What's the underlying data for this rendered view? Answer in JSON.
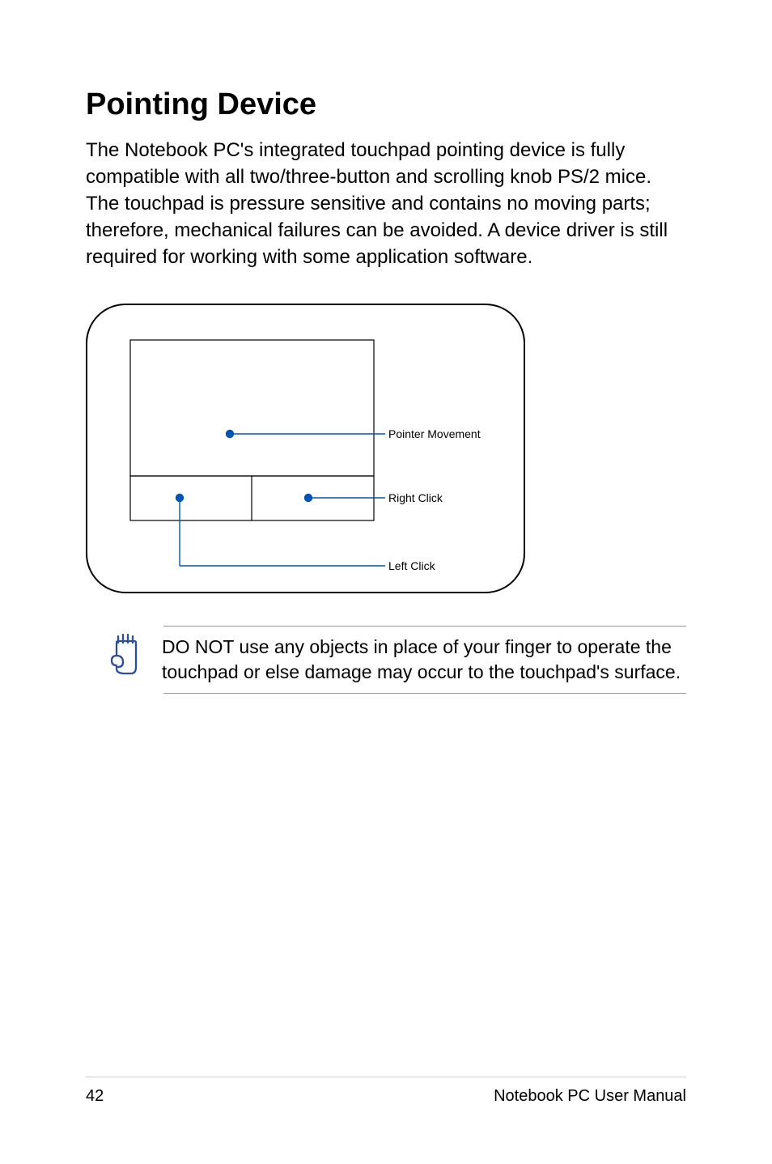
{
  "heading": "Pointing Device",
  "paragraph": "The Notebook PC's integrated touchpad pointing device is fully compatible with all two/three-button and scrolling knob PS/2 mice. The touchpad is pressure sensitive and contains no moving parts; therefore, mechanical failures can be avoided. A device driver is still required for working with some application software.",
  "diagram": {
    "labels": {
      "pointer": "Pointer Movement",
      "right": "Right Click",
      "left": "Left Click"
    }
  },
  "callout": "DO NOT use any objects in place of your finger to operate the touchpad or else damage may occur to the touchpad's surface.",
  "footer": {
    "page": "42",
    "title": "Notebook PC User Manual"
  },
  "colors": {
    "callout_blue": "#0054b3",
    "icon_stroke": "#2b4ea0"
  }
}
